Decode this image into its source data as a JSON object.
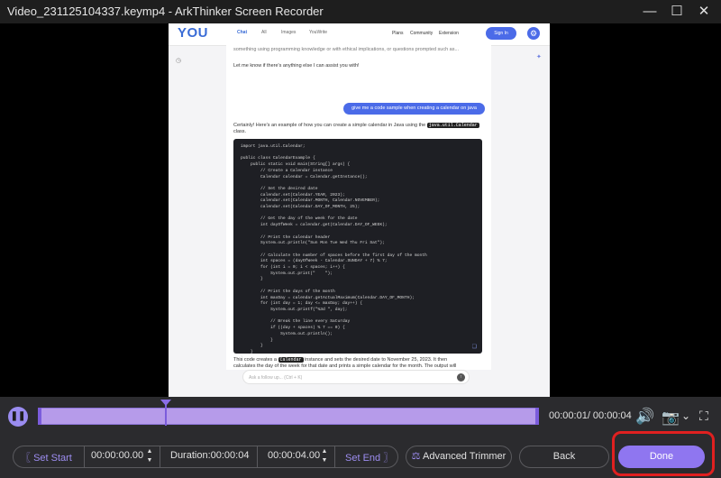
{
  "window": {
    "title": "Video_231125104337.keymp4  -  ArkThinker Screen Recorder"
  },
  "browser": {
    "logo": "YOU",
    "tabs": [
      "Chat",
      "All",
      "Images",
      "YouWrite"
    ],
    "nav": [
      "Plans",
      "Community",
      "Extension"
    ],
    "signin": "Sign In",
    "prev_text": "something using programming knowledge or with ethical implications, or questions prompted such as...",
    "let_me_know": "Let me know if there's anything else I can assist you with!",
    "user_message": "give me a code sample when creating a calendar on java",
    "response_intro": "Certainly! Here's an example of how you can create a simple calendar in Java using the",
    "response_class": "java.util.Calendar",
    "response_class_suffix": "class.",
    "code_lines": [
      "import java.util.Calendar;",
      "",
      "public class CalendarExample {",
      "    public static void main(String[] args) {",
      "        // Create a Calendar instance",
      "        Calendar calendar = Calendar.getInstance();",
      "",
      "        // Set the desired date",
      "        calendar.set(Calendar.YEAR, 2023);",
      "        calendar.set(Calendar.MONTH, Calendar.NOVEMBER);",
      "        calendar.set(Calendar.DAY_OF_MONTH, 25);",
      "",
      "        // Get the day of the week for the date",
      "        int dayOfWeek = calendar.get(Calendar.DAY_OF_WEEK);",
      "",
      "        // Print the calendar header",
      "        System.out.println(\"Sun Mon Tue Wed Thu Fri Sat\");",
      "",
      "        // Calculate the number of spaces before the first day of the month",
      "        int spaces = (dayOfWeek - Calendar.SUNDAY + 7) % 7;",
      "        for (int i = 0; i < spaces; i++) {",
      "            System.out.print(\"    \");",
      "        }",
      "",
      "        // Print the days of the month",
      "        int maxDay = calendar.getActualMaximum(Calendar.DAY_OF_MONTH);",
      "        for (int day = 1; day <= maxDay; day++) {",
      "            System.out.printf(\"%3d \", day);",
      "",
      "            // Break the line every Saturday",
      "            if ((day + spaces) % 7 == 0) {",
      "                System.out.println();",
      "            }",
      "        }",
      "    }",
      "}"
    ],
    "explain_a": "This code creates a",
    "explain_tag": "Calendar",
    "explain_b": "instance and sets the desired date to November 25, 2023. It then",
    "explain_2": "calculates the day of the week for that date and prints a simple calendar for the month. The output will",
    "followup_placeholder": "Ask a follow up...  (Ctrl + K)"
  },
  "timeline": {
    "current": "00:00:01",
    "total": "00:00:04",
    "time_display": "00:00:01/ 00:00:04",
    "progress": 0.25
  },
  "controls": {
    "set_start": "Set Start",
    "start_time": "00:00:00.00",
    "duration": "Duration:00:00:04",
    "end_time": "00:00:04.00",
    "set_end": "Set End",
    "advanced_trimmer": "Advanced Trimmer",
    "back": "Back",
    "done": "Done"
  },
  "colors": {
    "accent": "#8f76f0",
    "highlight": "#e02020",
    "track": "#b69bea"
  },
  "icons": {
    "play": "pause-icon",
    "volume": "volume-icon",
    "camera": "camera-icon",
    "fullscreen": "fullscreen-icon"
  }
}
